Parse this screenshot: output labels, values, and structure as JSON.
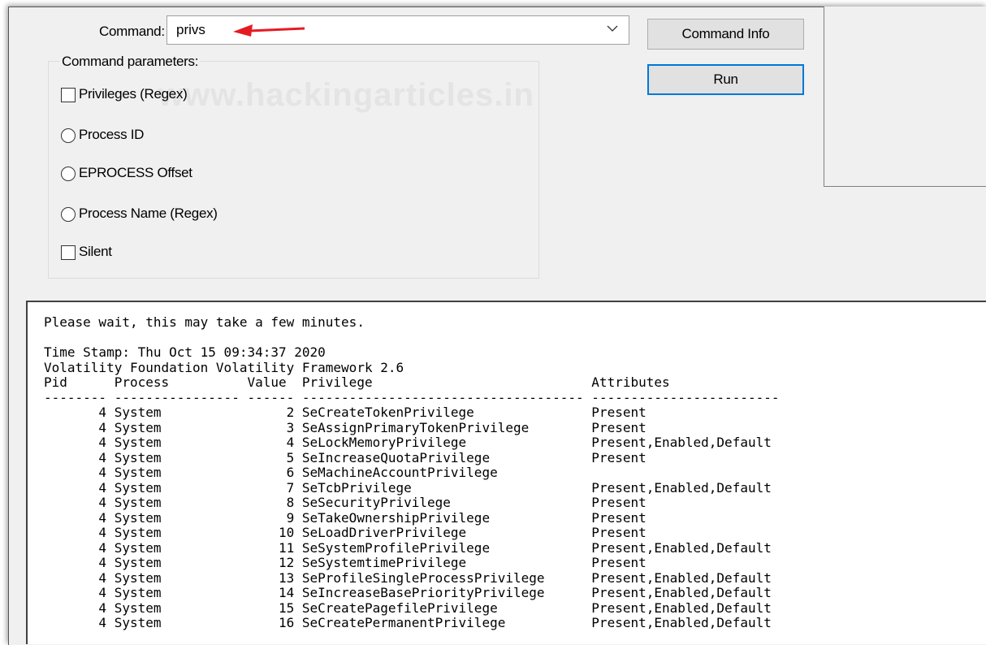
{
  "command": {
    "label": "Command:",
    "value": "privs"
  },
  "buttons": {
    "command_info": "Command Info",
    "run": "Run"
  },
  "params": {
    "title": "Command parameters:",
    "privileges": "Privileges (Regex)",
    "process_id": "Process ID",
    "eprocess": "EPROCESS Offset",
    "process_name": "Process Name (Regex)",
    "silent": "Silent"
  },
  "watermark": "www.hackingarticles.in",
  "output": {
    "wait": "Please wait, this may take a few minutes.",
    "timestamp": "Time Stamp: Thu Oct 15 09:34:37 2020",
    "framework": "Volatility Foundation Volatility Framework 2.6",
    "columns": [
      "Pid",
      "Process",
      "Value",
      "Privilege",
      "Attributes"
    ],
    "rows": [
      [
        "4",
        "System",
        "2",
        "SeCreateTokenPrivilege",
        "Present"
      ],
      [
        "4",
        "System",
        "3",
        "SeAssignPrimaryTokenPrivilege",
        "Present"
      ],
      [
        "4",
        "System",
        "4",
        "SeLockMemoryPrivilege",
        "Present,Enabled,Default"
      ],
      [
        "4",
        "System",
        "5",
        "SeIncreaseQuotaPrivilege",
        "Present"
      ],
      [
        "4",
        "System",
        "6",
        "SeMachineAccountPrivilege",
        ""
      ],
      [
        "4",
        "System",
        "7",
        "SeTcbPrivilege",
        "Present,Enabled,Default"
      ],
      [
        "4",
        "System",
        "8",
        "SeSecurityPrivilege",
        "Present"
      ],
      [
        "4",
        "System",
        "9",
        "SeTakeOwnershipPrivilege",
        "Present"
      ],
      [
        "4",
        "System",
        "10",
        "SeLoadDriverPrivilege",
        "Present"
      ],
      [
        "4",
        "System",
        "11",
        "SeSystemProfilePrivilege",
        "Present,Enabled,Default"
      ],
      [
        "4",
        "System",
        "12",
        "SeSystemtimePrivilege",
        "Present"
      ],
      [
        "4",
        "System",
        "13",
        "SeProfileSingleProcessPrivilege",
        "Present,Enabled,Default"
      ],
      [
        "4",
        "System",
        "14",
        "SeIncreaseBasePriorityPrivilege",
        "Present,Enabled,Default"
      ],
      [
        "4",
        "System",
        "15",
        "SeCreatePagefilePrivilege",
        "Present,Enabled,Default"
      ],
      [
        "4",
        "System",
        "16",
        "SeCreatePermanentPrivilege",
        "Present,Enabled,Default"
      ]
    ]
  },
  "colors": {
    "arrow": "#e51b24",
    "default_button_border": "#0078d7"
  }
}
